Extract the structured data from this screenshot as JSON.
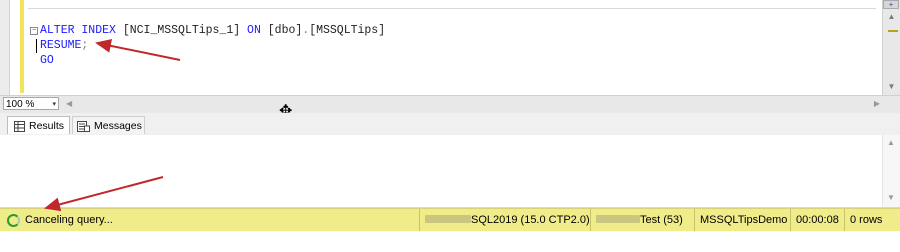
{
  "editor": {
    "lines": [
      {
        "parts": [
          {
            "text": "ALTER INDEX ",
            "cls": "kw"
          },
          {
            "text": "[NCI_MSSQLTips_1]",
            "cls": "txt"
          },
          {
            "text": " ON ",
            "cls": "kw"
          },
          {
            "text": "[dbo]",
            "cls": "txt"
          },
          {
            "text": ".",
            "cls": "op"
          },
          {
            "text": "[MSSQLTips]",
            "cls": "txt"
          }
        ]
      },
      {
        "parts": [
          {
            "text": "RESUME",
            "cls": "kw"
          },
          {
            "text": ";",
            "cls": "op"
          }
        ]
      },
      {
        "parts": [
          {
            "text": "GO",
            "cls": "kw"
          }
        ]
      }
    ],
    "collapse_glyph": "−",
    "split_glyph": "+"
  },
  "zoom": {
    "value": "100 %",
    "dropdown_glyph": "▾"
  },
  "tabs": {
    "results_label": "Results",
    "messages_label": "Messages"
  },
  "status": {
    "text": "Canceling query...",
    "server": "SQL2019 (15.0 CTP2.0)",
    "login": "Test (53)",
    "database": "MSSQLTipsDemo",
    "elapsed": "00:00:08",
    "rows": "0 rows"
  },
  "icons": {
    "resize_cursor": "move-cursor-icon",
    "status": "spinner-icon",
    "results": "grid-icon",
    "messages": "messages-icon"
  },
  "colors": {
    "status_bar": "#f1ec8a",
    "keyword": "#1a1aff",
    "arrow": "#c0282d",
    "change_bar": "#f3e35a"
  }
}
